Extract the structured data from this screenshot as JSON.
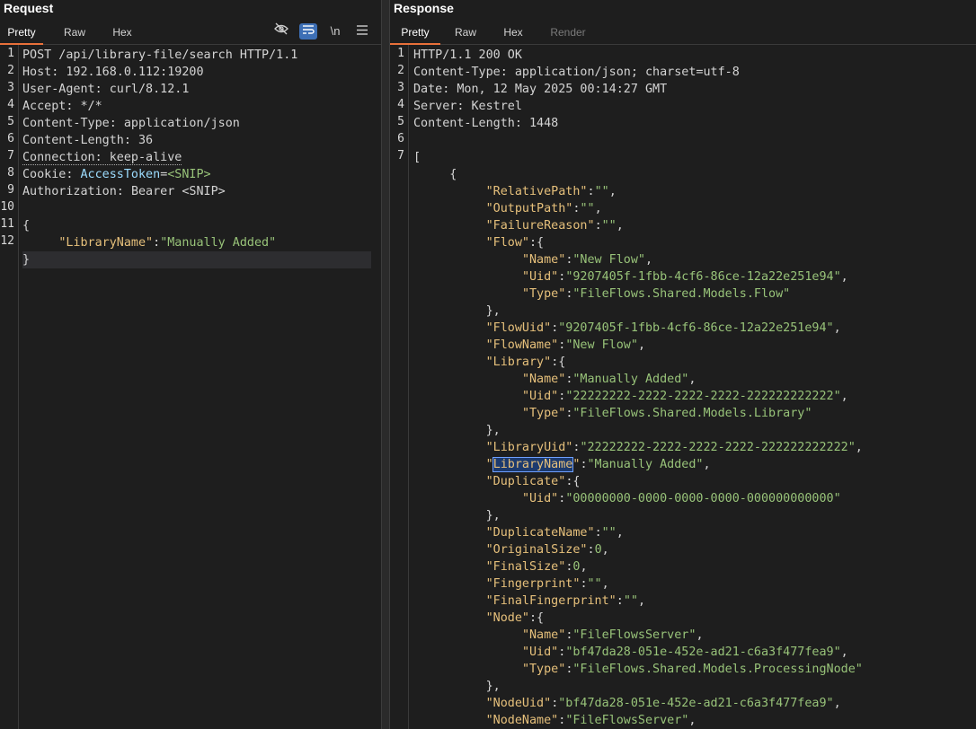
{
  "request": {
    "title": "Request",
    "tabs": [
      "Pretty",
      "Raw",
      "Hex"
    ],
    "active_tab": "Pretty",
    "toolbar_icons": [
      "eye-off-icon",
      "wrap-icon",
      "newline-icon",
      "menu-icon"
    ],
    "newline_label": "\\n",
    "lines": [
      {
        "num": "1",
        "parts": [
          {
            "t": "POST /api/library-file/search HTTP/1.1",
            "c": "p"
          }
        ]
      },
      {
        "num": "2",
        "parts": [
          {
            "t": "Host: ",
            "c": "p"
          },
          {
            "t": "192.168.0.112:19200",
            "c": "p"
          }
        ]
      },
      {
        "num": "3",
        "parts": [
          {
            "t": "User-Agent: ",
            "c": "p"
          },
          {
            "t": "curl/8.12.1",
            "c": "p"
          }
        ]
      },
      {
        "num": "4",
        "parts": [
          {
            "t": "Accept: ",
            "c": "p"
          },
          {
            "t": "*/*",
            "c": "p"
          }
        ]
      },
      {
        "num": "5",
        "parts": [
          {
            "t": "Content-Type: ",
            "c": "p"
          },
          {
            "t": "application/json",
            "c": "p"
          }
        ]
      },
      {
        "num": "6",
        "parts": [
          {
            "t": "Content-Length: ",
            "c": "p"
          },
          {
            "t": "36",
            "c": "p"
          }
        ]
      },
      {
        "num": "7",
        "parts": [
          {
            "t": "Connection: keep-alive",
            "c": "p dotted"
          }
        ]
      },
      {
        "num": "8",
        "parts": [
          {
            "t": "Cookie: ",
            "c": "p"
          },
          {
            "t": "AccessToken",
            "c": "blue"
          },
          {
            "t": "=",
            "c": "p"
          },
          {
            "t": "<SNIP>",
            "c": "s"
          }
        ]
      },
      {
        "num": "9",
        "parts": [
          {
            "t": "Authorization: ",
            "c": "p"
          },
          {
            "t": "Bearer <SNIP>",
            "c": "p"
          }
        ]
      },
      {
        "num": "10",
        "parts": []
      },
      {
        "num": "11",
        "parts": [
          {
            "t": "{",
            "c": "p"
          }
        ]
      },
      {
        "num": "12",
        "parts": [
          {
            "t": "     ",
            "c": "p"
          },
          {
            "t": "\"LibraryName\"",
            "c": "k"
          },
          {
            "t": ":",
            "c": "p"
          },
          {
            "t": "\"Manually Added\"",
            "c": "s"
          }
        ]
      },
      {
        "num": "",
        "parts": [
          {
            "t": "}",
            "c": "p"
          }
        ],
        "highlight": true
      }
    ]
  },
  "response": {
    "title": "Response",
    "tabs": [
      "Pretty",
      "Raw",
      "Hex",
      "Render"
    ],
    "active_tab": "Pretty",
    "lines": [
      {
        "num": "1",
        "parts": [
          {
            "t": "HTTP/1.1 200 OK",
            "c": "p"
          }
        ]
      },
      {
        "num": "2",
        "parts": [
          {
            "t": "Content-Type: ",
            "c": "p"
          },
          {
            "t": "application/json; charset=utf-8",
            "c": "p"
          }
        ]
      },
      {
        "num": "3",
        "parts": [
          {
            "t": "Date: ",
            "c": "p"
          },
          {
            "t": "Mon, 12 May 2025 00:14:27 GMT",
            "c": "p"
          }
        ]
      },
      {
        "num": "4",
        "parts": [
          {
            "t": "Server: ",
            "c": "p"
          },
          {
            "t": "Kestrel",
            "c": "p"
          }
        ]
      },
      {
        "num": "5",
        "parts": [
          {
            "t": "Content-Length: ",
            "c": "p"
          },
          {
            "t": "1448",
            "c": "p"
          }
        ]
      },
      {
        "num": "6",
        "parts": []
      },
      {
        "num": "7",
        "parts": [
          {
            "t": "[",
            "c": "p"
          }
        ]
      },
      {
        "num": "",
        "parts": [
          {
            "t": "     {",
            "c": "p"
          }
        ]
      },
      {
        "num": "",
        "parts": [
          {
            "t": "          ",
            "c": "p"
          },
          {
            "t": "\"RelativePath\"",
            "c": "k"
          },
          {
            "t": ":",
            "c": "p"
          },
          {
            "t": "\"\"",
            "c": "s"
          },
          {
            "t": ",",
            "c": "p"
          }
        ]
      },
      {
        "num": "",
        "parts": [
          {
            "t": "          ",
            "c": "p"
          },
          {
            "t": "\"OutputPath\"",
            "c": "k"
          },
          {
            "t": ":",
            "c": "p"
          },
          {
            "t": "\"\"",
            "c": "s"
          },
          {
            "t": ",",
            "c": "p"
          }
        ]
      },
      {
        "num": "",
        "parts": [
          {
            "t": "          ",
            "c": "p"
          },
          {
            "t": "\"FailureReason\"",
            "c": "k"
          },
          {
            "t": ":",
            "c": "p"
          },
          {
            "t": "\"\"",
            "c": "s"
          },
          {
            "t": ",",
            "c": "p"
          }
        ]
      },
      {
        "num": "",
        "parts": [
          {
            "t": "          ",
            "c": "p"
          },
          {
            "t": "\"Flow\"",
            "c": "k"
          },
          {
            "t": ":{",
            "c": "p"
          }
        ]
      },
      {
        "num": "",
        "parts": [
          {
            "t": "               ",
            "c": "p"
          },
          {
            "t": "\"Name\"",
            "c": "k"
          },
          {
            "t": ":",
            "c": "p"
          },
          {
            "t": "\"New Flow\"",
            "c": "s"
          },
          {
            "t": ",",
            "c": "p"
          }
        ]
      },
      {
        "num": "",
        "parts": [
          {
            "t": "               ",
            "c": "p"
          },
          {
            "t": "\"Uid\"",
            "c": "k"
          },
          {
            "t": ":",
            "c": "p"
          },
          {
            "t": "\"9207405f-1fbb-4cf6-86ce-12a22e251e94\"",
            "c": "s"
          },
          {
            "t": ",",
            "c": "p"
          }
        ]
      },
      {
        "num": "",
        "parts": [
          {
            "t": "               ",
            "c": "p"
          },
          {
            "t": "\"Type\"",
            "c": "k"
          },
          {
            "t": ":",
            "c": "p"
          },
          {
            "t": "\"FileFlows.Shared.Models.Flow\"",
            "c": "s"
          }
        ]
      },
      {
        "num": "",
        "parts": [
          {
            "t": "          },",
            "c": "p"
          }
        ]
      },
      {
        "num": "",
        "parts": [
          {
            "t": "          ",
            "c": "p"
          },
          {
            "t": "\"FlowUid\"",
            "c": "k"
          },
          {
            "t": ":",
            "c": "p"
          },
          {
            "t": "\"9207405f-1fbb-4cf6-86ce-12a22e251e94\"",
            "c": "s"
          },
          {
            "t": ",",
            "c": "p"
          }
        ]
      },
      {
        "num": "",
        "parts": [
          {
            "t": "          ",
            "c": "p"
          },
          {
            "t": "\"FlowName\"",
            "c": "k"
          },
          {
            "t": ":",
            "c": "p"
          },
          {
            "t": "\"New Flow\"",
            "c": "s"
          },
          {
            "t": ",",
            "c": "p"
          }
        ]
      },
      {
        "num": "",
        "parts": [
          {
            "t": "          ",
            "c": "p"
          },
          {
            "t": "\"Library\"",
            "c": "k"
          },
          {
            "t": ":{",
            "c": "p"
          }
        ]
      },
      {
        "num": "",
        "parts": [
          {
            "t": "               ",
            "c": "p"
          },
          {
            "t": "\"Name\"",
            "c": "k"
          },
          {
            "t": ":",
            "c": "p"
          },
          {
            "t": "\"Manually Added\"",
            "c": "s"
          },
          {
            "t": ",",
            "c": "p"
          }
        ]
      },
      {
        "num": "",
        "parts": [
          {
            "t": "               ",
            "c": "p"
          },
          {
            "t": "\"Uid\"",
            "c": "k"
          },
          {
            "t": ":",
            "c": "p"
          },
          {
            "t": "\"22222222-2222-2222-2222-222222222222\"",
            "c": "s"
          },
          {
            "t": ",",
            "c": "p"
          }
        ]
      },
      {
        "num": "",
        "parts": [
          {
            "t": "               ",
            "c": "p"
          },
          {
            "t": "\"Type\"",
            "c": "k"
          },
          {
            "t": ":",
            "c": "p"
          },
          {
            "t": "\"FileFlows.Shared.Models.Library\"",
            "c": "s"
          }
        ]
      },
      {
        "num": "",
        "parts": [
          {
            "t": "          },",
            "c": "p"
          }
        ]
      },
      {
        "num": "",
        "parts": [
          {
            "t": "          ",
            "c": "p"
          },
          {
            "t": "\"LibraryUid\"",
            "c": "k"
          },
          {
            "t": ":",
            "c": "p"
          },
          {
            "t": "\"22222222-2222-2222-2222-222222222222\"",
            "c": "s"
          },
          {
            "t": ",",
            "c": "p"
          }
        ]
      },
      {
        "num": "",
        "parts": [
          {
            "t": "          ",
            "c": "p"
          },
          {
            "t": "\"",
            "c": "k"
          },
          {
            "t": "LibraryName",
            "c": "k sel"
          },
          {
            "t": "\"",
            "c": "k"
          },
          {
            "t": ":",
            "c": "p"
          },
          {
            "t": "\"Manually Added\"",
            "c": "s"
          },
          {
            "t": ",",
            "c": "p"
          }
        ]
      },
      {
        "num": "",
        "parts": [
          {
            "t": "          ",
            "c": "p"
          },
          {
            "t": "\"Duplicate\"",
            "c": "k"
          },
          {
            "t": ":{",
            "c": "p"
          }
        ]
      },
      {
        "num": "",
        "parts": [
          {
            "t": "               ",
            "c": "p"
          },
          {
            "t": "\"Uid\"",
            "c": "k"
          },
          {
            "t": ":",
            "c": "p"
          },
          {
            "t": "\"00000000-0000-0000-0000-000000000000\"",
            "c": "s"
          }
        ]
      },
      {
        "num": "",
        "parts": [
          {
            "t": "          },",
            "c": "p"
          }
        ]
      },
      {
        "num": "",
        "parts": [
          {
            "t": "          ",
            "c": "p"
          },
          {
            "t": "\"DuplicateName\"",
            "c": "k"
          },
          {
            "t": ":",
            "c": "p"
          },
          {
            "t": "\"\"",
            "c": "s"
          },
          {
            "t": ",",
            "c": "p"
          }
        ]
      },
      {
        "num": "",
        "parts": [
          {
            "t": "          ",
            "c": "p"
          },
          {
            "t": "\"OriginalSize\"",
            "c": "k"
          },
          {
            "t": ":",
            "c": "p"
          },
          {
            "t": "0",
            "c": "s"
          },
          {
            "t": ",",
            "c": "p"
          }
        ]
      },
      {
        "num": "",
        "parts": [
          {
            "t": "          ",
            "c": "p"
          },
          {
            "t": "\"FinalSize\"",
            "c": "k"
          },
          {
            "t": ":",
            "c": "p"
          },
          {
            "t": "0",
            "c": "s"
          },
          {
            "t": ",",
            "c": "p"
          }
        ]
      },
      {
        "num": "",
        "parts": [
          {
            "t": "          ",
            "c": "p"
          },
          {
            "t": "\"Fingerprint\"",
            "c": "k"
          },
          {
            "t": ":",
            "c": "p"
          },
          {
            "t": "\"\"",
            "c": "s"
          },
          {
            "t": ",",
            "c": "p"
          }
        ]
      },
      {
        "num": "",
        "parts": [
          {
            "t": "          ",
            "c": "p"
          },
          {
            "t": "\"FinalFingerprint\"",
            "c": "k"
          },
          {
            "t": ":",
            "c": "p"
          },
          {
            "t": "\"\"",
            "c": "s"
          },
          {
            "t": ",",
            "c": "p"
          }
        ]
      },
      {
        "num": "",
        "parts": [
          {
            "t": "          ",
            "c": "p"
          },
          {
            "t": "\"Node\"",
            "c": "k"
          },
          {
            "t": ":{",
            "c": "p"
          }
        ]
      },
      {
        "num": "",
        "parts": [
          {
            "t": "               ",
            "c": "p"
          },
          {
            "t": "\"Name\"",
            "c": "k"
          },
          {
            "t": ":",
            "c": "p"
          },
          {
            "t": "\"FileFlowsServer\"",
            "c": "s"
          },
          {
            "t": ",",
            "c": "p"
          }
        ]
      },
      {
        "num": "",
        "parts": [
          {
            "t": "               ",
            "c": "p"
          },
          {
            "t": "\"Uid\"",
            "c": "k"
          },
          {
            "t": ":",
            "c": "p"
          },
          {
            "t": "\"bf47da28-051e-452e-ad21-c6a3f477fea9\"",
            "c": "s"
          },
          {
            "t": ",",
            "c": "p"
          }
        ]
      },
      {
        "num": "",
        "parts": [
          {
            "t": "               ",
            "c": "p"
          },
          {
            "t": "\"Type\"",
            "c": "k"
          },
          {
            "t": ":",
            "c": "p"
          },
          {
            "t": "\"FileFlows.Shared.Models.ProcessingNode\"",
            "c": "s"
          }
        ]
      },
      {
        "num": "",
        "parts": [
          {
            "t": "          },",
            "c": "p"
          }
        ]
      },
      {
        "num": "",
        "parts": [
          {
            "t": "          ",
            "c": "p"
          },
          {
            "t": "\"NodeUid\"",
            "c": "k"
          },
          {
            "t": ":",
            "c": "p"
          },
          {
            "t": "\"bf47da28-051e-452e-ad21-c6a3f477fea9\"",
            "c": "s"
          },
          {
            "t": ",",
            "c": "p"
          }
        ]
      },
      {
        "num": "",
        "parts": [
          {
            "t": "          ",
            "c": "p"
          },
          {
            "t": "\"NodeName\"",
            "c": "k"
          },
          {
            "t": ":",
            "c": "p"
          },
          {
            "t": "\"FileFlowsServer\"",
            "c": "s"
          },
          {
            "t": ",",
            "c": "p"
          }
        ]
      }
    ]
  },
  "colors": {
    "key": "#e6c07b",
    "string": "#98c379",
    "accent": "#e8703a",
    "selection": "#1c3a6e"
  }
}
